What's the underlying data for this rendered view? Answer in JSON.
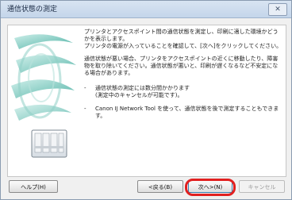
{
  "window": {
    "title": "通信状態の測定",
    "close_label": "✕"
  },
  "body": {
    "paragraphs": [
      "プリンタとアクセスポイント間の通信状態を測定し、印刷に適した環境かどうかを表示します。",
      "プリンタの電源が入っていることを確認して、[次へ]をクリックしてください。",
      "通信状態が悪い場合、プリンタをアクセスポイントの近くに移動したり、障害物を取り除いてください。通信状態が悪いと、印刷が遅くなるなど不安定になる場合があります。"
    ],
    "bullets": [
      "通信状態の測定には数分間かかります\n(測定中のキャンセルが可能です)。",
      "Canon IJ Network Tool を使って、通信状態を後で測定することもできます。"
    ]
  },
  "buttons": {
    "help": "ヘルプ(H)",
    "back": "<戻る(B)",
    "next": "次へ>(N)",
    "cancel": "キャンセル"
  }
}
